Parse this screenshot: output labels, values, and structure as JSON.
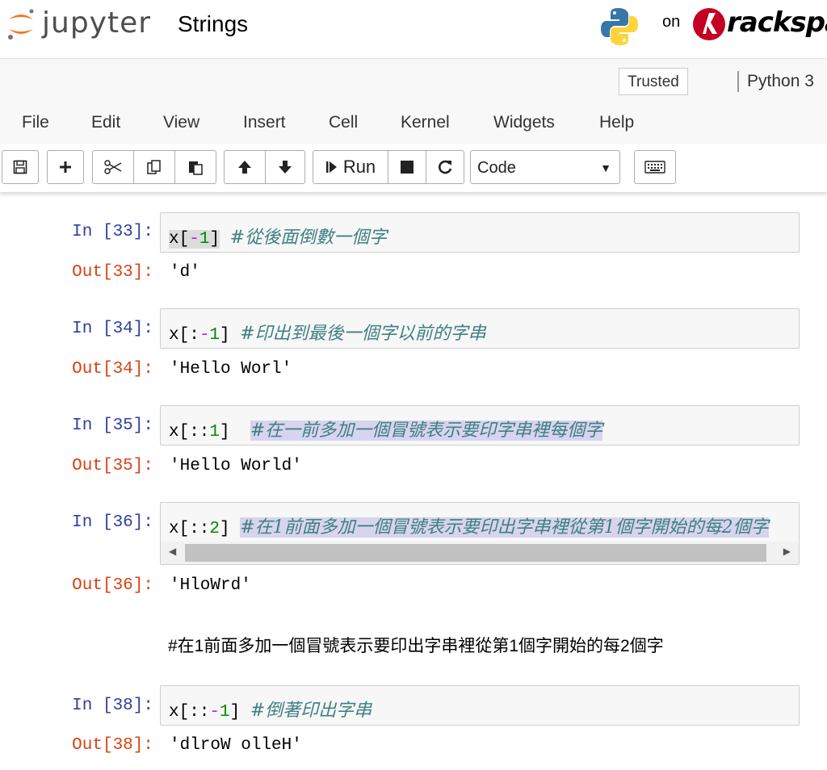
{
  "header": {
    "logo_text": "jupyter",
    "notebook_title": "Strings",
    "on_text": "on",
    "sponsor_text": "rackspace"
  },
  "status": {
    "trusted_label": "Trusted",
    "kernel_label": "Python 3"
  },
  "menu": [
    "File",
    "Edit",
    "View",
    "Insert",
    "Cell",
    "Kernel",
    "Widgets",
    "Help"
  ],
  "toolbar": {
    "run_label": "Run",
    "cell_type": "Code",
    "icons": [
      "save-icon",
      "plus-icon",
      "scissors-icon",
      "copy-icon",
      "paste-icon",
      "arrow-up-icon",
      "arrow-down-icon",
      "run-icon",
      "stop-icon",
      "restart-icon",
      "keyboard-icon"
    ]
  },
  "cells": [
    {
      "in_prompt": "In [33]:",
      "code_var": "x",
      "code_slice": "[-1]",
      "code_open": "[",
      "code_mid": "-",
      "code_num": "1",
      "code_close": "]",
      "comment": "#從後面倒數一個字",
      "out_prompt": "Out[33]:",
      "output": "'d'"
    },
    {
      "in_prompt": "In [34]:",
      "code_open": "x[:",
      "code_mid": "-",
      "code_num": "1",
      "code_close": "]",
      "comment": "#印出到最後一個字以前的字串",
      "out_prompt": "Out[34]:",
      "output": "'Hello Worl'"
    },
    {
      "in_prompt": "In [35]:",
      "code_open": "x[::",
      "code_num": "1",
      "code_close": "]",
      "comment": "#在一前多加一個冒號表示要印字串裡每個字",
      "out_prompt": "Out[35]:",
      "output": "'Hello World'"
    },
    {
      "in_prompt": "In [36]:",
      "code_open": "x[::",
      "code_num": "2",
      "code_close": "]",
      "comment": "#在1前面多加一個冒號表示要印出字串裡從第1個字開始的每2個字",
      "out_prompt": "Out[36]:",
      "output": "'HloWrd'"
    },
    {
      "in_prompt": "In [38]:",
      "code_open": "x[::",
      "code_mid": "-",
      "code_num": "1",
      "code_close": "]",
      "comment": "#倒著印出字串",
      "out_prompt": "Out[38]:",
      "output": "'dlroW olleH'"
    }
  ],
  "markdown_text": "#在1前面多加一個冒號表示要印出字串裡從第1個字開始的每2個字"
}
